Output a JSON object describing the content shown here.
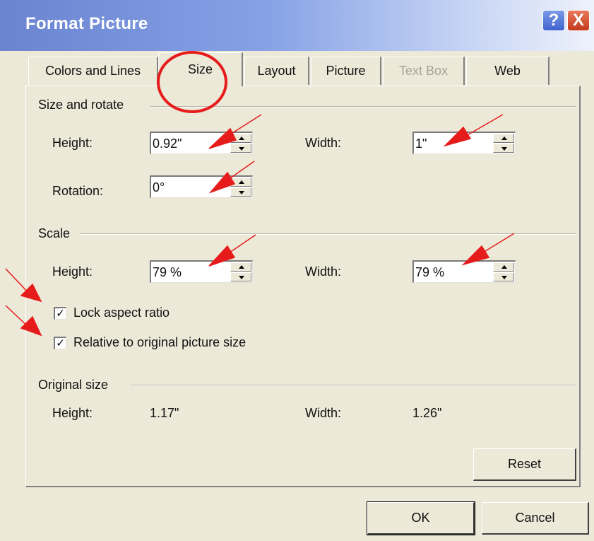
{
  "window": {
    "title": "Format Picture",
    "help_glyph": "?",
    "close_glyph": "X"
  },
  "tabs": [
    {
      "label": "Colors and Lines",
      "state": "normal"
    },
    {
      "label": "Size",
      "state": "active"
    },
    {
      "label": "Layout",
      "state": "normal"
    },
    {
      "label": "Picture",
      "state": "normal"
    },
    {
      "label": "Text Box",
      "state": "disabled"
    },
    {
      "label": "Web",
      "state": "normal"
    }
  ],
  "size_rotate": {
    "heading": "Size and rotate",
    "height_label": "Height:",
    "height_value": "0.92\"",
    "width_label": "Width:",
    "width_value": "1\"",
    "rotation_label": "Rotation:",
    "rotation_value": "0°"
  },
  "scale": {
    "heading": "Scale",
    "height_label": "Height:",
    "height_value": "79 %",
    "width_label": "Width:",
    "width_value": "79 %",
    "lock_aspect_label": "Lock aspect ratio",
    "lock_aspect_checked": true,
    "relative_label": "Relative to original picture size",
    "relative_checked": true
  },
  "original_size": {
    "heading": "Original size",
    "height_label": "Height:",
    "height_value": "1.17\"",
    "width_label": "Width:",
    "width_value": "1.26\""
  },
  "buttons": {
    "reset": "Reset",
    "ok": "OK",
    "cancel": "Cancel"
  },
  "annotation_colors": {
    "circle": "#e61c1c",
    "arrow": "#e61c1c"
  }
}
